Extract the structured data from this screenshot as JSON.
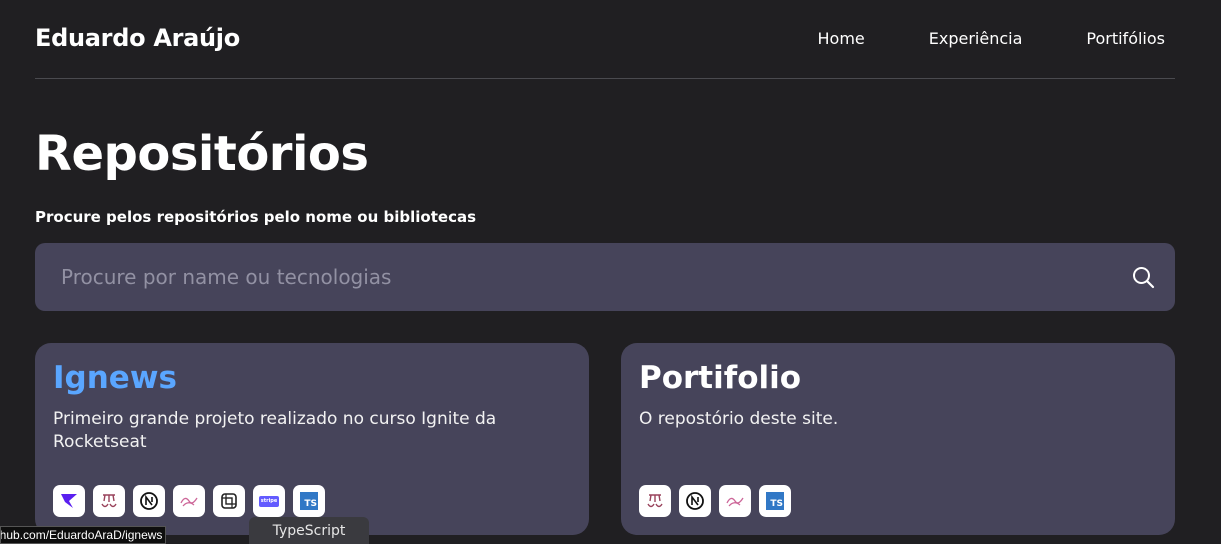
{
  "header": {
    "brand": "Eduardo Araújo",
    "nav": [
      "Home",
      "Experiência",
      "Portifólios"
    ]
  },
  "main": {
    "title": "Repositórios",
    "subtitle": "Procure pelos repositórios pelo nome ou bibliotecas",
    "search": {
      "placeholder": "Procure por name ou tecnologias",
      "value": ""
    }
  },
  "repos": [
    {
      "title": "Ignews",
      "description": "Primeiro grande projeto realizado no curso Ignite da Rocketseat",
      "title_color": "#5aa6ff",
      "techs": [
        "prismic-icon",
        "jest-icon",
        "nextjs-icon",
        "sass-icon",
        "faunadb-icon",
        "stripe-icon",
        "typescript-icon"
      ],
      "stripe_label": "stripe",
      "ts_label": "TS"
    },
    {
      "title": "Portifolio",
      "description": "O repostório deste site.",
      "techs": [
        "jest-icon",
        "nextjs-icon",
        "sass-icon",
        "typescript-icon"
      ],
      "ts_label": "TS"
    }
  ],
  "tooltip": "TypeScript",
  "status_url": "github.com/EduardoAraD/ignews",
  "colors": {
    "background": "#201f22",
    "card": "#46445a",
    "accent": "#5aa6ff"
  }
}
